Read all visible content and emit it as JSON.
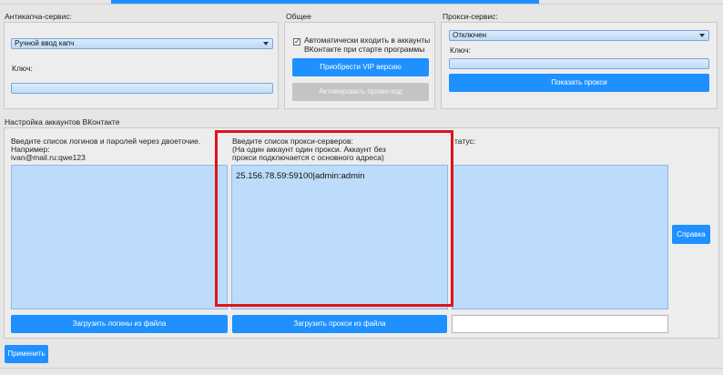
{
  "anticaptcha": {
    "group_label": "Антикапча-сервис:",
    "selected": "Ручной ввод капч",
    "key_label": "Ключ:"
  },
  "general": {
    "group_label": "Общее",
    "auto_login_label": "Автоматически входить в аккаунты ВКонтакте при старте программы",
    "buy_vip_label": "Приобрести VIP версию",
    "activate_promo_label": "Активировать промо-код"
  },
  "proxy_service": {
    "group_label": "Прокси-сервис:",
    "selected": "Отключен",
    "key_label": "Ключ:",
    "show_proxies_label": "Показать прокси"
  },
  "accounts": {
    "group_label": "Настройка аккаунтов ВКонтакте",
    "logins_hint_1": "Введите список логинов и паролей через двоеточие.",
    "logins_hint_2": "Например:",
    "logins_hint_3": "ivan@mail.ru:qwe123",
    "load_logins_label": "Загрузить логины из файла",
    "proxies_hint_1": "Введите список прокси-серверов:",
    "proxies_hint_2": "(На один аккаунт один прокси. Аккаунт без",
    "proxies_hint_3": "прокси подключается с основного адреса)",
    "proxies_value": "25.156.78.59:59100|admin:admin",
    "load_proxies_label": "Загрузить прокси из файла",
    "status_label": "татус:",
    "help_label": "Справка"
  },
  "apply_label": "Применить"
}
